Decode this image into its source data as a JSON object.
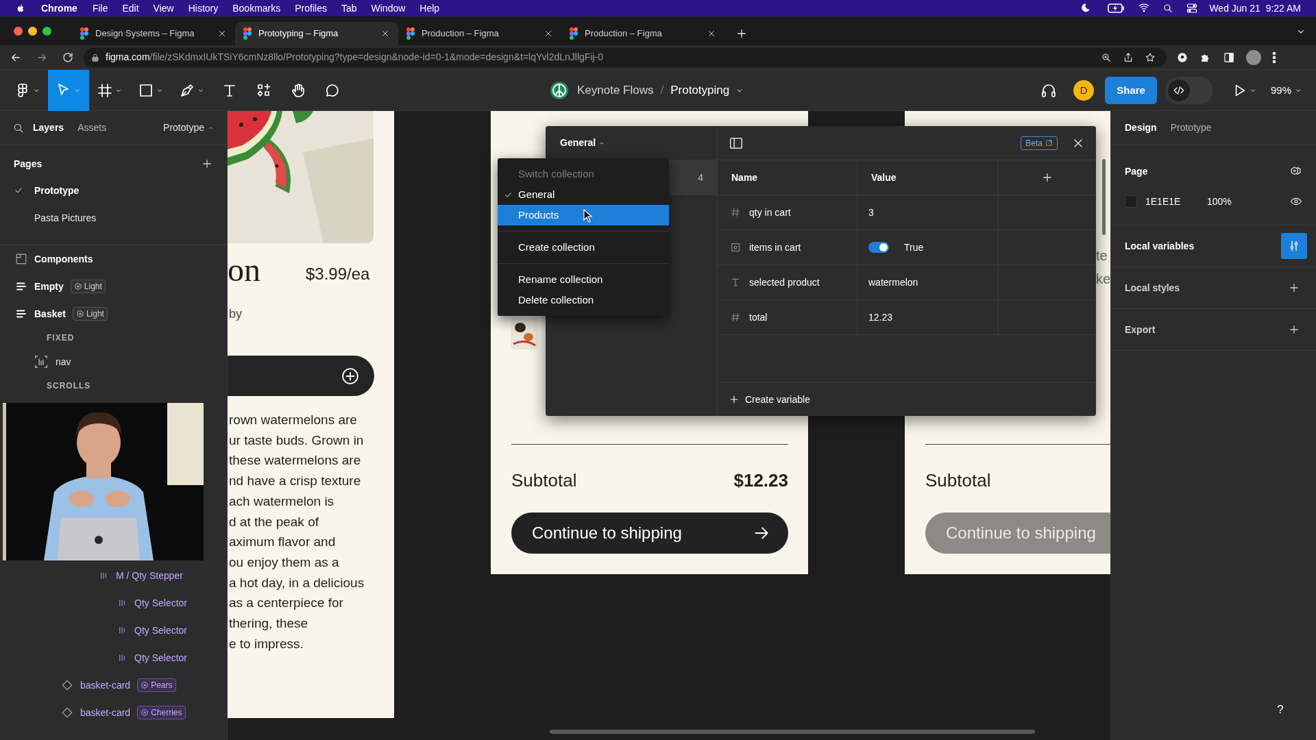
{
  "menubar": {
    "app": "Chrome",
    "menus": [
      "File",
      "Edit",
      "View",
      "History",
      "Bookmarks",
      "Profiles",
      "Tab",
      "Window",
      "Help"
    ],
    "clock": "Wed Jun 21  9:22 AM"
  },
  "browser_tabs": [
    {
      "title": "Design Systems – Figma",
      "selected": false
    },
    {
      "title": "Prototyping – Figma",
      "selected": true
    },
    {
      "title": "Production – Figma",
      "selected": false
    },
    {
      "title": "Production – Figma",
      "selected": false
    }
  ],
  "address_bar": {
    "host": "figma.com",
    "path": "/file/zSKdmxIUkTSiY6cmNz8llo/Prototyping?type=design&node-id=0-1&mode=design&t=lqYvl2dLnJllgFij-0"
  },
  "toolbar": {
    "tools": [
      {
        "kind": "main-menu",
        "selected": false
      },
      {
        "kind": "move",
        "selected": true
      },
      {
        "kind": "frame",
        "selected": false
      },
      {
        "kind": "shape",
        "selected": false
      },
      {
        "kind": "pen",
        "selected": false
      },
      {
        "kind": "text",
        "selected": false
      },
      {
        "kind": "resources",
        "selected": false
      },
      {
        "kind": "hand",
        "selected": false
      },
      {
        "kind": "comment",
        "selected": false
      }
    ],
    "project": "Keynote Flows",
    "separator": "/",
    "page": "Prototyping",
    "avatar": "D",
    "share": "Share",
    "dev_mode": false,
    "zoom": "99%"
  },
  "left_panel": {
    "tabs": [
      {
        "label": "Layers",
        "selected": true
      },
      {
        "label": "Assets",
        "selected": false
      }
    ],
    "page_menu": "Prototype",
    "pages_title": "Pages",
    "pages": [
      {
        "label": "Prototype",
        "selected": true
      },
      {
        "label": "Pasta Pictures",
        "selected": false
      }
    ],
    "layers": [
      {
        "kind": "section",
        "label": "Components"
      },
      {
        "kind": "frame",
        "label": "Empty",
        "badge": "Light"
      },
      {
        "kind": "frame",
        "label": "Basket",
        "badge": "Light",
        "children": [
          {
            "kind": "heading",
            "label": "FIXED"
          },
          {
            "kind": "frame-layer",
            "label": "nav"
          },
          {
            "kind": "heading",
            "label": "SCROLLS"
          },
          {
            "kind": "picture"
          },
          {
            "kind": "instance",
            "label": "M / Qty Stepper",
            "children": [
              {
                "kind": "instance",
                "label": "Qty Selector"
              },
              {
                "kind": "instance",
                "label": "Qty Selector"
              },
              {
                "kind": "instance",
                "label": "Qty Selector"
              }
            ]
          },
          {
            "kind": "component",
            "label": "basket-card",
            "badge": "Pears"
          },
          {
            "kind": "component",
            "label": "basket-card",
            "badge": "Cherries"
          }
        ]
      }
    ]
  },
  "canvas": {
    "product_frame": {
      "title_fragment": "on",
      "price": "$3.99/ea",
      "byline_fragment": "by",
      "description_lines": [
        "rown watermelons are",
        "ur taste buds. Grown in",
        "these watermelons are",
        "nd have a crisp texture",
        "ach watermelon is",
        "d at the peak of",
        "aximum flavor and",
        "ou enjoy them as a",
        "a hot day, in a delicious",
        "as a centerpiece for",
        "thering, these",
        "e to impress."
      ]
    },
    "basket_frame": {
      "subtotal_label": "Subtotal",
      "subtotal": "$12.23",
      "button": "Continue to shipping",
      "disabled": false
    },
    "basket_frame_2": {
      "text_fragments": [
        "te",
        "ke"
      ],
      "subtotal_label": "Subtotal",
      "button": "Continue to shipping",
      "disabled": true
    }
  },
  "variables_dialog": {
    "collection": "General",
    "count": "4",
    "beta": "Beta",
    "columns": [
      "Name",
      "Value"
    ],
    "rows": [
      {
        "kind": "number",
        "name": "qty in cart",
        "value": "3"
      },
      {
        "kind": "boolean",
        "name": "items in cart",
        "value": "True",
        "on": true
      },
      {
        "kind": "string",
        "name": "selected product",
        "value": "watermelon"
      },
      {
        "kind": "number",
        "name": "total",
        "value": "12.23"
      }
    ],
    "create": "Create variable"
  },
  "collection_menu": {
    "header": "Switch collection",
    "items": [
      {
        "label": "General",
        "checked": true,
        "selected": false
      },
      {
        "label": "Products",
        "checked": false,
        "selected": true
      }
    ],
    "actions": [
      [
        "Create collection"
      ],
      [
        "Rename collection",
        "Delete collection"
      ]
    ]
  },
  "right_panel": {
    "tabs": [
      {
        "label": "Design",
        "selected": true
      },
      {
        "label": "Prototype",
        "selected": false
      }
    ],
    "page": {
      "title": "Page",
      "color": "1E1E1E",
      "opacity": "100%"
    },
    "sections": [
      {
        "label": "Local variables",
        "active": true
      },
      {
        "label": "Local styles",
        "active": false
      },
      {
        "label": "Export",
        "active": false
      }
    ],
    "help": "?"
  }
}
